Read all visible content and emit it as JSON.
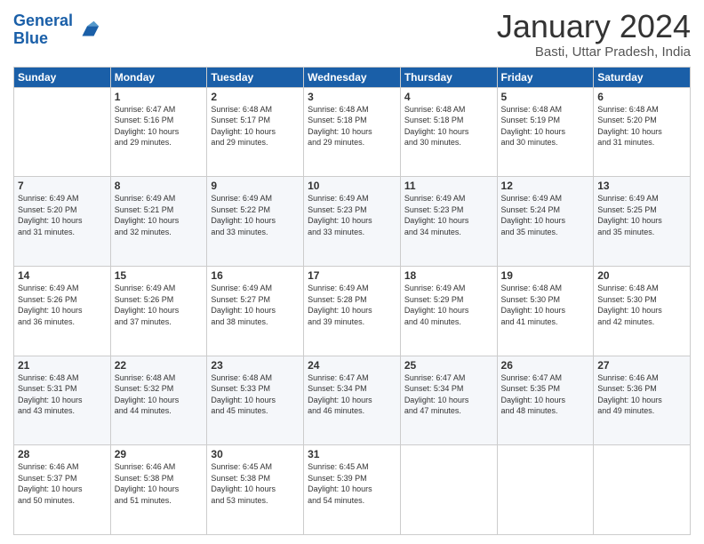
{
  "logo": {
    "line1": "General",
    "line2": "Blue"
  },
  "title": "January 2024",
  "location": "Basti, Uttar Pradesh, India",
  "days_of_week": [
    "Sunday",
    "Monday",
    "Tuesday",
    "Wednesday",
    "Thursday",
    "Friday",
    "Saturday"
  ],
  "weeks": [
    [
      {
        "day": "",
        "info": ""
      },
      {
        "day": "1",
        "info": "Sunrise: 6:47 AM\nSunset: 5:16 PM\nDaylight: 10 hours\nand 29 minutes."
      },
      {
        "day": "2",
        "info": "Sunrise: 6:48 AM\nSunset: 5:17 PM\nDaylight: 10 hours\nand 29 minutes."
      },
      {
        "day": "3",
        "info": "Sunrise: 6:48 AM\nSunset: 5:18 PM\nDaylight: 10 hours\nand 29 minutes."
      },
      {
        "day": "4",
        "info": "Sunrise: 6:48 AM\nSunset: 5:18 PM\nDaylight: 10 hours\nand 30 minutes."
      },
      {
        "day": "5",
        "info": "Sunrise: 6:48 AM\nSunset: 5:19 PM\nDaylight: 10 hours\nand 30 minutes."
      },
      {
        "day": "6",
        "info": "Sunrise: 6:48 AM\nSunset: 5:20 PM\nDaylight: 10 hours\nand 31 minutes."
      }
    ],
    [
      {
        "day": "7",
        "info": "Sunrise: 6:49 AM\nSunset: 5:20 PM\nDaylight: 10 hours\nand 31 minutes."
      },
      {
        "day": "8",
        "info": "Sunrise: 6:49 AM\nSunset: 5:21 PM\nDaylight: 10 hours\nand 32 minutes."
      },
      {
        "day": "9",
        "info": "Sunrise: 6:49 AM\nSunset: 5:22 PM\nDaylight: 10 hours\nand 33 minutes."
      },
      {
        "day": "10",
        "info": "Sunrise: 6:49 AM\nSunset: 5:23 PM\nDaylight: 10 hours\nand 33 minutes."
      },
      {
        "day": "11",
        "info": "Sunrise: 6:49 AM\nSunset: 5:23 PM\nDaylight: 10 hours\nand 34 minutes."
      },
      {
        "day": "12",
        "info": "Sunrise: 6:49 AM\nSunset: 5:24 PM\nDaylight: 10 hours\nand 35 minutes."
      },
      {
        "day": "13",
        "info": "Sunrise: 6:49 AM\nSunset: 5:25 PM\nDaylight: 10 hours\nand 35 minutes."
      }
    ],
    [
      {
        "day": "14",
        "info": "Sunrise: 6:49 AM\nSunset: 5:26 PM\nDaylight: 10 hours\nand 36 minutes."
      },
      {
        "day": "15",
        "info": "Sunrise: 6:49 AM\nSunset: 5:26 PM\nDaylight: 10 hours\nand 37 minutes."
      },
      {
        "day": "16",
        "info": "Sunrise: 6:49 AM\nSunset: 5:27 PM\nDaylight: 10 hours\nand 38 minutes."
      },
      {
        "day": "17",
        "info": "Sunrise: 6:49 AM\nSunset: 5:28 PM\nDaylight: 10 hours\nand 39 minutes."
      },
      {
        "day": "18",
        "info": "Sunrise: 6:49 AM\nSunset: 5:29 PM\nDaylight: 10 hours\nand 40 minutes."
      },
      {
        "day": "19",
        "info": "Sunrise: 6:48 AM\nSunset: 5:30 PM\nDaylight: 10 hours\nand 41 minutes."
      },
      {
        "day": "20",
        "info": "Sunrise: 6:48 AM\nSunset: 5:30 PM\nDaylight: 10 hours\nand 42 minutes."
      }
    ],
    [
      {
        "day": "21",
        "info": "Sunrise: 6:48 AM\nSunset: 5:31 PM\nDaylight: 10 hours\nand 43 minutes."
      },
      {
        "day": "22",
        "info": "Sunrise: 6:48 AM\nSunset: 5:32 PM\nDaylight: 10 hours\nand 44 minutes."
      },
      {
        "day": "23",
        "info": "Sunrise: 6:48 AM\nSunset: 5:33 PM\nDaylight: 10 hours\nand 45 minutes."
      },
      {
        "day": "24",
        "info": "Sunrise: 6:47 AM\nSunset: 5:34 PM\nDaylight: 10 hours\nand 46 minutes."
      },
      {
        "day": "25",
        "info": "Sunrise: 6:47 AM\nSunset: 5:34 PM\nDaylight: 10 hours\nand 47 minutes."
      },
      {
        "day": "26",
        "info": "Sunrise: 6:47 AM\nSunset: 5:35 PM\nDaylight: 10 hours\nand 48 minutes."
      },
      {
        "day": "27",
        "info": "Sunrise: 6:46 AM\nSunset: 5:36 PM\nDaylight: 10 hours\nand 49 minutes."
      }
    ],
    [
      {
        "day": "28",
        "info": "Sunrise: 6:46 AM\nSunset: 5:37 PM\nDaylight: 10 hours\nand 50 minutes."
      },
      {
        "day": "29",
        "info": "Sunrise: 6:46 AM\nSunset: 5:38 PM\nDaylight: 10 hours\nand 51 minutes."
      },
      {
        "day": "30",
        "info": "Sunrise: 6:45 AM\nSunset: 5:38 PM\nDaylight: 10 hours\nand 53 minutes."
      },
      {
        "day": "31",
        "info": "Sunrise: 6:45 AM\nSunset: 5:39 PM\nDaylight: 10 hours\nand 54 minutes."
      },
      {
        "day": "",
        "info": ""
      },
      {
        "day": "",
        "info": ""
      },
      {
        "day": "",
        "info": ""
      }
    ]
  ]
}
